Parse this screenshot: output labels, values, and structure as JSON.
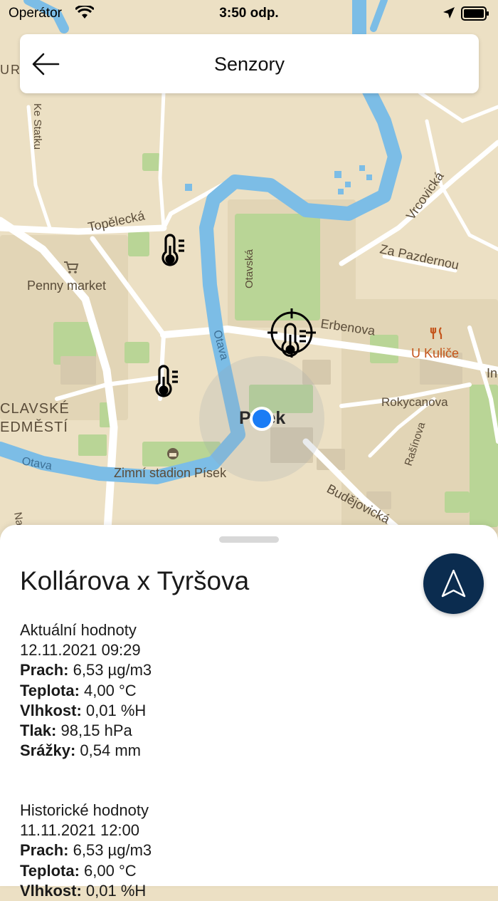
{
  "status_bar": {
    "carrier": "Operátor",
    "time": "3:50 odp."
  },
  "header": {
    "title": "Senzory",
    "back_icon": "arrow-left-icon"
  },
  "map": {
    "labels": {
      "ke_statku": "Ke Statku",
      "topelecka": "Topělecká",
      "penny": "Penny market",
      "otavska": "Otavská",
      "vrcovicka": "Vrcovická",
      "za_pazdernou": "Za Pazdernou",
      "erbenova": "Erbenova",
      "u_kulice": "U Kuliče",
      "rokycanova": "Rokycanova",
      "rasinova": "Rašínova",
      "budejovicka": "Budějovická",
      "otava_river": "Otava",
      "otava_river2": "Otava",
      "zimni": "Zimní stadion Písek",
      "vaclavske": "CLAVSKÉ",
      "predmesti": "EDMĚSTÍ",
      "pisek": "Písek",
      "in": "In",
      "na": "Na",
      "uri": "URI"
    },
    "accent_color": "#1a7cf5",
    "water_color": "#7cbde6",
    "park_color": "#b9d596",
    "restaurant_color": "#c4551c"
  },
  "sheet": {
    "title": "Kollárova x Tyršova",
    "nav_icon": "navigation-arrow-icon",
    "current": {
      "heading": "Aktuální hodnoty",
      "timestamp": "12.11.2021 09:29",
      "rows": [
        {
          "label": "Prach:",
          "value": "6,53 µg/m3"
        },
        {
          "label": "Teplota:",
          "value": "4,00 °C"
        },
        {
          "label": "Vlhkost:",
          "value": "0,01 %H"
        },
        {
          "label": "Tlak:",
          "value": "98,15 hPa"
        },
        {
          "label": "Srážky:",
          "value": "0,54 mm"
        }
      ]
    },
    "history": {
      "heading": "Historické hodnoty",
      "timestamp": "11.11.2021 12:00",
      "rows": [
        {
          "label": "Prach:",
          "value": "6,53 µg/m3"
        },
        {
          "label": "Teplota:",
          "value": "6,00 °C"
        },
        {
          "label": "Vlhkost:",
          "value": "0,01 %H"
        }
      ]
    }
  }
}
